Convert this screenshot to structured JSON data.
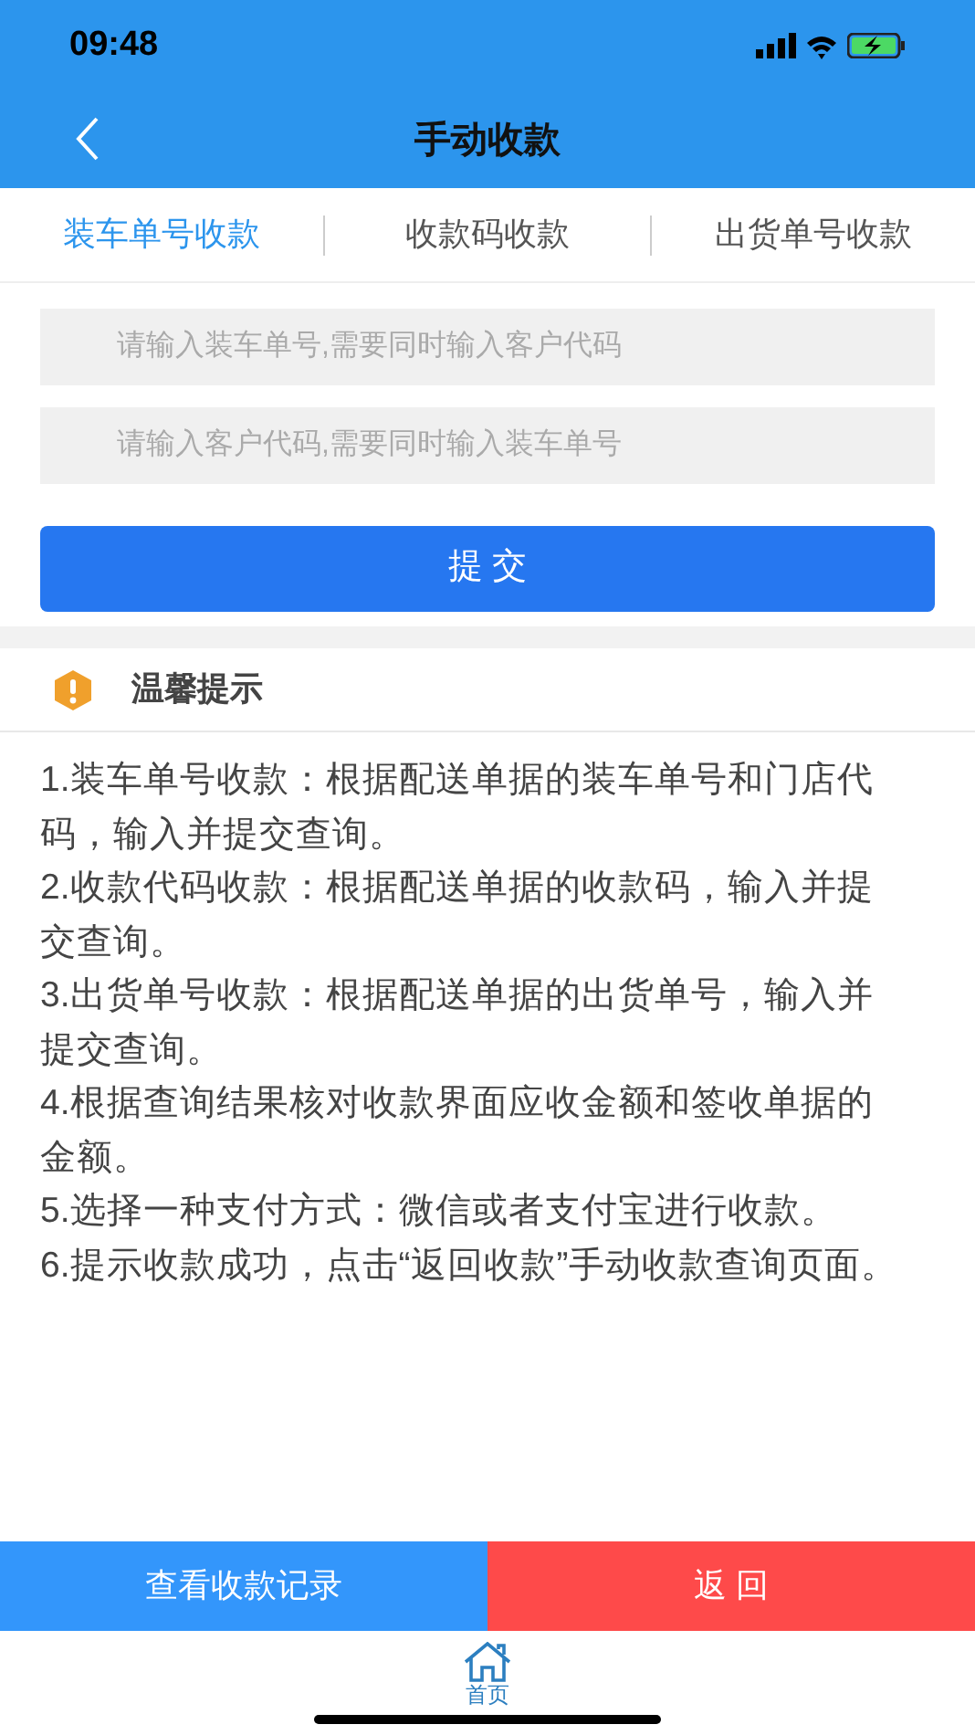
{
  "status_bar": {
    "time": "09:48"
  },
  "nav": {
    "title": "手动收款"
  },
  "tabs": [
    {
      "label": "装车单号收款",
      "selected": true
    },
    {
      "label": "收款码收款",
      "selected": false
    },
    {
      "label": "出货单号收款",
      "selected": false
    }
  ],
  "fields": [
    {
      "placeholder": "请输入装车单号,需要同时输入客户代码"
    },
    {
      "placeholder": "请输入客户代码,需要同时输入装车单号"
    }
  ],
  "submit": "提 交",
  "tips": {
    "title": "温馨提示",
    "items": [
      "1.装车单号收款：根据配送单据的装车单号和门店代码，输入并提交查询。",
      "2.收款代码收款：根据配送单据的收款码，输入并提交查询。",
      "3.出货单号收款：根据配送单据的出货单号，输入并提交查询。",
      "4.根据查询结果核对收款界面应收金额和签收单据的金额。",
      "5.选择一种支付方式：微信或者支付宝进行收款。",
      "6.提示收款成功，点击“返回收款”手动收款查询页面。"
    ]
  },
  "actions": {
    "records": "查看收款记录",
    "back": "返 回"
  },
  "tab_bar": [
    {
      "label": "首页"
    }
  ]
}
